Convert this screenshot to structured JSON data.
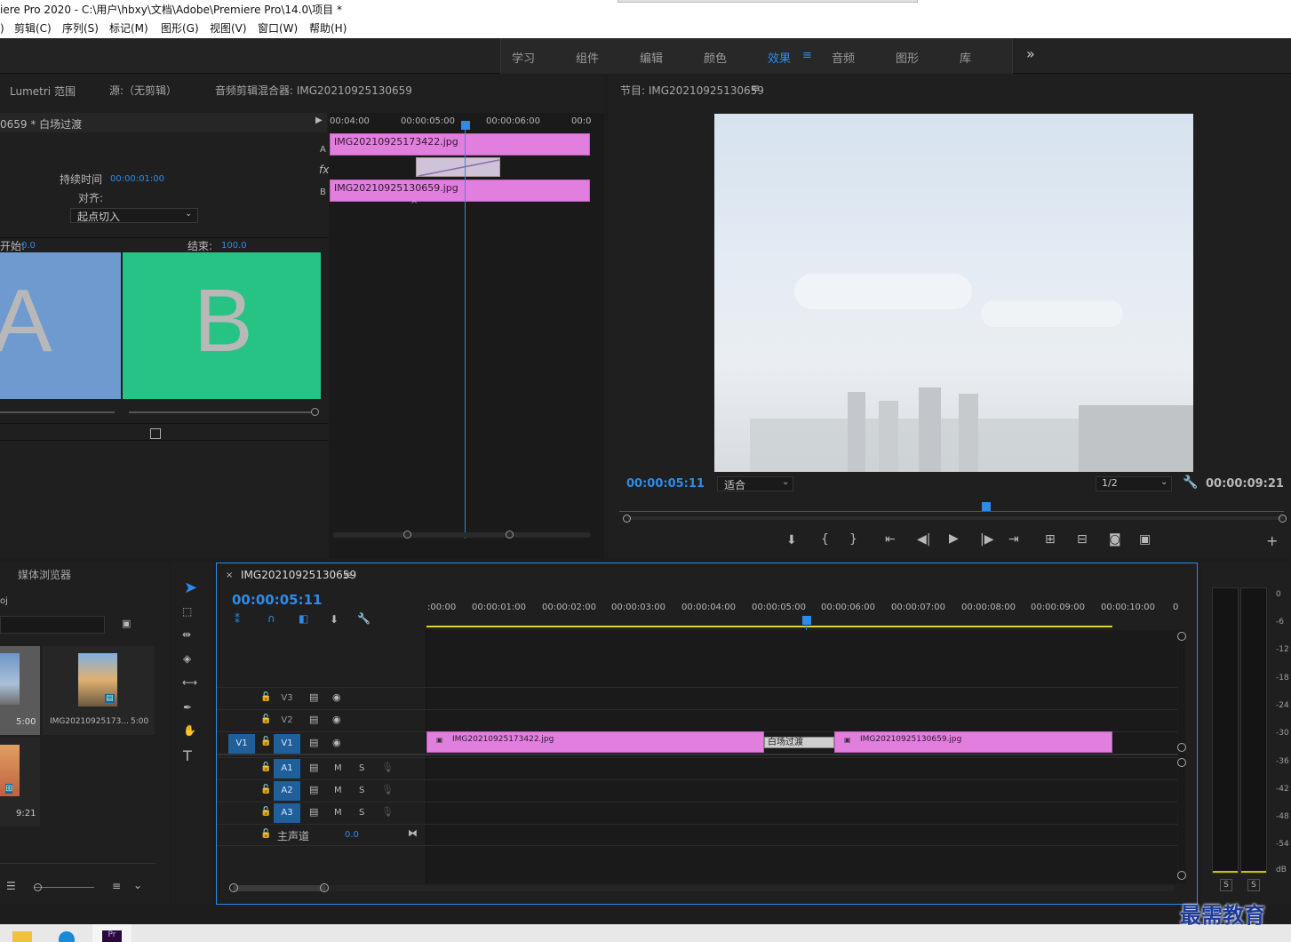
{
  "window": {
    "title": "iere Pro 2020 - C:\\用户\\hbxy\\文档\\Adobe\\Premiere Pro\\14.0\\项目 *"
  },
  "menu": [
    "剪辑(C)",
    "序列(S)",
    "标记(M)",
    "图形(G)",
    "视图(V)",
    "窗口(W)",
    "帮助(H)"
  ],
  "workspaces": [
    "学习",
    "组件",
    "编辑",
    "颜色",
    "效果",
    "音频",
    "图形",
    "库"
  ],
  "active_workspace": "效果",
  "workspace_more": "»",
  "source_panel": {
    "tabs": [
      "Lumetri 范围",
      "源:（无剪辑）",
      "音频剪辑混合器: IMG20210925130659"
    ],
    "transition_name": "0659 * 白场过渡",
    "duration_label": "持续时间",
    "duration_value": "00:00:01:00",
    "align_label": "对齐:",
    "align_value": "起点切入",
    "start_label": "开始:",
    "start_value": "0.0",
    "end_label": "结束:",
    "end_value": "100.0",
    "preview_a": "A",
    "preview_b": "B",
    "mini_ruler": [
      "00:04:00",
      "00:00:05:00",
      "00:00:06:00",
      "00:0"
    ],
    "clip_a": "IMG20210925173422.jpg",
    "clip_b": "IMG20210925130659.jpg",
    "track_a": "A",
    "track_b": "B",
    "fx": "fx"
  },
  "program_panel": {
    "title": "节目: IMG20210925130659",
    "current_time": "00:00:05:11",
    "fit": "适合",
    "resolution": "1/2",
    "duration": "00:00:09:21"
  },
  "project_panel": {
    "title": "媒体浏览器",
    "path": "oj",
    "items": [
      {
        "name": "",
        "duration": "5:00"
      },
      {
        "name": "IMG20210925173...",
        "duration": "5:00"
      },
      {
        "name": "",
        "duration": "9:21"
      }
    ]
  },
  "timeline": {
    "sequence": "IMG20210925130659",
    "current_time": "00:00:05:11",
    "ruler": [
      ":00:00",
      "00:00:01:00",
      "00:00:02:00",
      "00:00:03:00",
      "00:00:04:00",
      "00:00:05:00",
      "00:00:06:00",
      "00:00:07:00",
      "00:00:08:00",
      "00:00:09:00",
      "00:00:10:00",
      "0"
    ],
    "video_tracks": [
      "V3",
      "V2",
      "V1"
    ],
    "audio_tracks": [
      "A1",
      "A2",
      "A3"
    ],
    "source_patch_v": "V1",
    "master": "主声道",
    "master_value": "0.0",
    "clip1": "IMG20210925173422.jpg",
    "clip2": "IMG20210925130659.jpg",
    "transition": "白场过渡",
    "mute": "M",
    "solo": "S"
  },
  "meter": {
    "labels": [
      "0",
      "-6",
      "-12",
      "-18",
      "-24",
      "-30",
      "-36",
      "-42",
      "-48",
      "-54",
      "dB"
    ],
    "solo_l": "S",
    "solo_r": "S"
  },
  "watermark": "最需教育"
}
